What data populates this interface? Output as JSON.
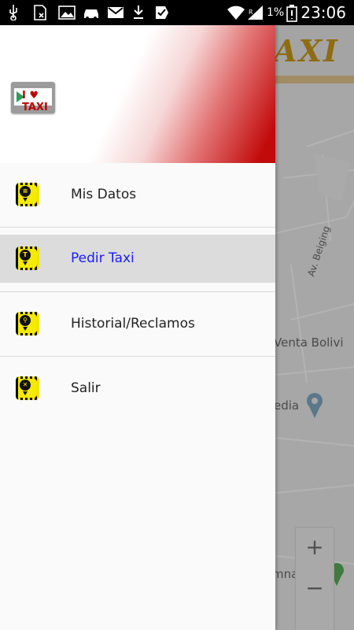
{
  "status_bar": {
    "battery_percent": "1%",
    "time": "23:06",
    "icons": [
      "usb-icon",
      "sim-icon",
      "image-icon",
      "car-icon",
      "gmail-icon",
      "download-icon",
      "check-icon",
      "wifi-icon",
      "signal-icon",
      "battery-icon"
    ]
  },
  "background": {
    "app_title_fragment": "AXI",
    "map_labels": {
      "street_1": "Av. Beiging",
      "place_1": "Venta Bolivi",
      "place_2": "edia",
      "place_3": "mnasia"
    },
    "zoom_in": "+",
    "zoom_out": "−"
  },
  "drawer": {
    "logo_text": "I ♥ TAXI",
    "items": [
      {
        "label": "Mis Datos",
        "icon": "taxi-user-icon",
        "selected": false
      },
      {
        "label": "Pedir Taxi",
        "icon": "taxi-request-icon",
        "selected": true
      },
      {
        "label": "Historial/Reclamos",
        "icon": "taxi-history-icon",
        "selected": false
      },
      {
        "label": "Salir",
        "icon": "taxi-exit-icon",
        "selected": false
      }
    ]
  },
  "colors": {
    "accent_red": "#c10a0a",
    "selected_text": "#1a1aff",
    "taxi_yellow": "#f5ea00"
  }
}
